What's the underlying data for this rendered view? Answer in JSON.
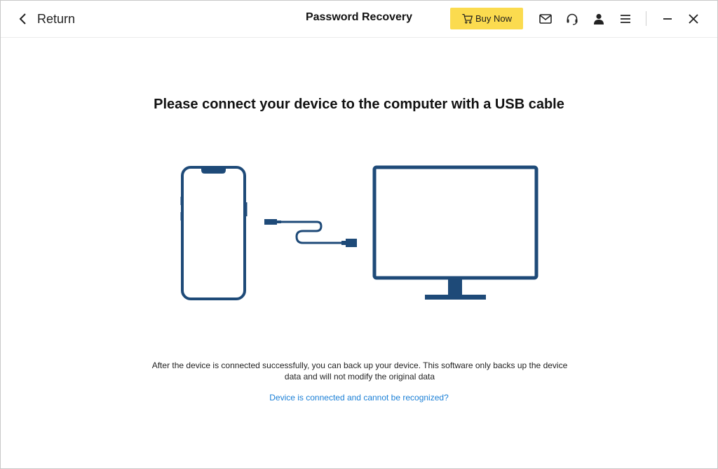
{
  "header": {
    "back_label": "Return",
    "title": "Password Recovery",
    "buy_label": "Buy Now",
    "icons": [
      "mail-icon",
      "headset-icon",
      "user-icon",
      "menu-icon",
      "minimize-icon",
      "close-icon"
    ]
  },
  "main": {
    "heading": "Please connect your device to the computer with a USB cable",
    "info": "After the device is connected successfully, you can back up your device. This software only backs up the device data and will not modify the original data",
    "help_link": "Device is connected and cannot be recognized?"
  },
  "colors": {
    "accent_yellow": "#fbdb4f",
    "illustration_blue": "#1e4a78",
    "link_blue": "#1a7fd6"
  }
}
